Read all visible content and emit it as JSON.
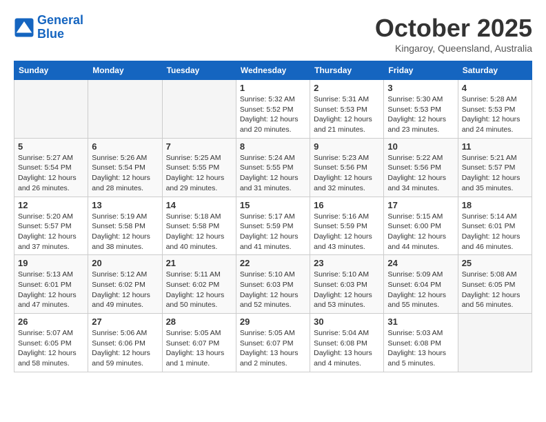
{
  "header": {
    "logo_line1": "General",
    "logo_line2": "Blue",
    "title": "October 2025",
    "location": "Kingaroy, Queensland, Australia"
  },
  "weekdays": [
    "Sunday",
    "Monday",
    "Tuesday",
    "Wednesday",
    "Thursday",
    "Friday",
    "Saturday"
  ],
  "weeks": [
    [
      {
        "day": "",
        "info": ""
      },
      {
        "day": "",
        "info": ""
      },
      {
        "day": "",
        "info": ""
      },
      {
        "day": "1",
        "info": "Sunrise: 5:32 AM\nSunset: 5:52 PM\nDaylight: 12 hours\nand 20 minutes."
      },
      {
        "day": "2",
        "info": "Sunrise: 5:31 AM\nSunset: 5:53 PM\nDaylight: 12 hours\nand 21 minutes."
      },
      {
        "day": "3",
        "info": "Sunrise: 5:30 AM\nSunset: 5:53 PM\nDaylight: 12 hours\nand 23 minutes."
      },
      {
        "day": "4",
        "info": "Sunrise: 5:28 AM\nSunset: 5:53 PM\nDaylight: 12 hours\nand 24 minutes."
      }
    ],
    [
      {
        "day": "5",
        "info": "Sunrise: 5:27 AM\nSunset: 5:54 PM\nDaylight: 12 hours\nand 26 minutes."
      },
      {
        "day": "6",
        "info": "Sunrise: 5:26 AM\nSunset: 5:54 PM\nDaylight: 12 hours\nand 28 minutes."
      },
      {
        "day": "7",
        "info": "Sunrise: 5:25 AM\nSunset: 5:55 PM\nDaylight: 12 hours\nand 29 minutes."
      },
      {
        "day": "8",
        "info": "Sunrise: 5:24 AM\nSunset: 5:55 PM\nDaylight: 12 hours\nand 31 minutes."
      },
      {
        "day": "9",
        "info": "Sunrise: 5:23 AM\nSunset: 5:56 PM\nDaylight: 12 hours\nand 32 minutes."
      },
      {
        "day": "10",
        "info": "Sunrise: 5:22 AM\nSunset: 5:56 PM\nDaylight: 12 hours\nand 34 minutes."
      },
      {
        "day": "11",
        "info": "Sunrise: 5:21 AM\nSunset: 5:57 PM\nDaylight: 12 hours\nand 35 minutes."
      }
    ],
    [
      {
        "day": "12",
        "info": "Sunrise: 5:20 AM\nSunset: 5:57 PM\nDaylight: 12 hours\nand 37 minutes."
      },
      {
        "day": "13",
        "info": "Sunrise: 5:19 AM\nSunset: 5:58 PM\nDaylight: 12 hours\nand 38 minutes."
      },
      {
        "day": "14",
        "info": "Sunrise: 5:18 AM\nSunset: 5:58 PM\nDaylight: 12 hours\nand 40 minutes."
      },
      {
        "day": "15",
        "info": "Sunrise: 5:17 AM\nSunset: 5:59 PM\nDaylight: 12 hours\nand 41 minutes."
      },
      {
        "day": "16",
        "info": "Sunrise: 5:16 AM\nSunset: 5:59 PM\nDaylight: 12 hours\nand 43 minutes."
      },
      {
        "day": "17",
        "info": "Sunrise: 5:15 AM\nSunset: 6:00 PM\nDaylight: 12 hours\nand 44 minutes."
      },
      {
        "day": "18",
        "info": "Sunrise: 5:14 AM\nSunset: 6:01 PM\nDaylight: 12 hours\nand 46 minutes."
      }
    ],
    [
      {
        "day": "19",
        "info": "Sunrise: 5:13 AM\nSunset: 6:01 PM\nDaylight: 12 hours\nand 47 minutes."
      },
      {
        "day": "20",
        "info": "Sunrise: 5:12 AM\nSunset: 6:02 PM\nDaylight: 12 hours\nand 49 minutes."
      },
      {
        "day": "21",
        "info": "Sunrise: 5:11 AM\nSunset: 6:02 PM\nDaylight: 12 hours\nand 50 minutes."
      },
      {
        "day": "22",
        "info": "Sunrise: 5:10 AM\nSunset: 6:03 PM\nDaylight: 12 hours\nand 52 minutes."
      },
      {
        "day": "23",
        "info": "Sunrise: 5:10 AM\nSunset: 6:03 PM\nDaylight: 12 hours\nand 53 minutes."
      },
      {
        "day": "24",
        "info": "Sunrise: 5:09 AM\nSunset: 6:04 PM\nDaylight: 12 hours\nand 55 minutes."
      },
      {
        "day": "25",
        "info": "Sunrise: 5:08 AM\nSunset: 6:05 PM\nDaylight: 12 hours\nand 56 minutes."
      }
    ],
    [
      {
        "day": "26",
        "info": "Sunrise: 5:07 AM\nSunset: 6:05 PM\nDaylight: 12 hours\nand 58 minutes."
      },
      {
        "day": "27",
        "info": "Sunrise: 5:06 AM\nSunset: 6:06 PM\nDaylight: 12 hours\nand 59 minutes."
      },
      {
        "day": "28",
        "info": "Sunrise: 5:05 AM\nSunset: 6:07 PM\nDaylight: 13 hours\nand 1 minute."
      },
      {
        "day": "29",
        "info": "Sunrise: 5:05 AM\nSunset: 6:07 PM\nDaylight: 13 hours\nand 2 minutes."
      },
      {
        "day": "30",
        "info": "Sunrise: 5:04 AM\nSunset: 6:08 PM\nDaylight: 13 hours\nand 4 minutes."
      },
      {
        "day": "31",
        "info": "Sunrise: 5:03 AM\nSunset: 6:08 PM\nDaylight: 13 hours\nand 5 minutes."
      },
      {
        "day": "",
        "info": ""
      }
    ]
  ]
}
